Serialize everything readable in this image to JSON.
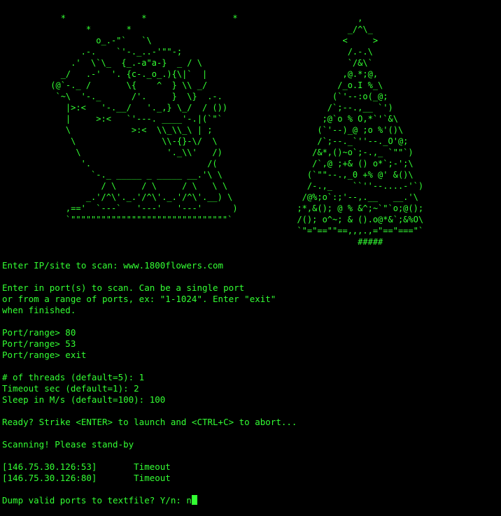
{
  "colors": {
    "background": "#000000",
    "text": "#33ff33"
  },
  "art": {
    "left": "            *               *                 *\n                 *       *\n                   o_.-\"`   `\\\n                .-.    `'-._..-'\"\"-;\n              .'  \\`\\_  {_.-a\"a-}  _ / \\\n            _/   .-'  '. {c-._o_.){\\|`  |\n          (@`-._ /       \\{    ^  } \\\\ _/\n           `~\\  '-._      /'.     }  \\}  .-.\n             |>:<   '-.__/   '._,} \\_/  / ())\n             |     >:<   `'---. ____'-.|(`\"`\n             \\            >:<  \\\\_\\\\_\\ | ;\n              \\                 \\\\-{}-\\/  \\\n               \\                 '._\\\\'   /)\n                '.                       /(\n                  `-._ _____ _ _____ __.'\\ \\\n                    / \\     / \\     / \\   \\ \\\n                 _.'/^\\'._.'/^\\'._.'/^\\'.__) \\\n             ,=='  `---`   '---'   '---'      )\n             `\"\"\"\"\"\"\"\"\"\"\"\"\"\"\"\"\"\"\"\"\"\"\"\"\"\"\"\"\"\"\"`",
    "right": "              ,\n            _/^\\_\n           <     >\n            /.-.\\\n            `/&\\`\n           ,@.*;@,\n          /_o.I %_\\\n         (`'--:o(_@;\n        /`;--.,__ `')\n       ;@`o % O,*`'`&\\\n      (`'--)_@ ;o %'()\\\n      /`;--._`''--._O'@;\n     /&*,()~o`;-.,_ `\"\"`)\n     /`,@ ;+& () o*`;-';\\\n    (`\"\"--.,_0 +% @' &()\\\n    /-.,_    ``''--....-'`)\n   /@%;o`:;'--,.__   __.'\\\n  ;*,&(); @ % &^;~`\"`o;@();\n  /(); o^~; & ().o@*&`;&%O\\\n  `\"=\"==\"\"==,,,.,=\"==\"===\"`\n              #####",
    "stars": "                                                                             *\n                                                         *\n                                                                         *                *         *\n   *                                                       *\n                                                                                             *\n                                                                                                     *\n                                                           *              *\n                                                                   *             *\n                                                                 *\n   *                                                      *\n                                                                                                     *\n                                                         *   *\n                                                                                                     *\n          *                                                                        *\n                                                                *\n                                                                                                     *\n       *                                                                                    *\n                                                               *"
  },
  "output": {
    "prompt_site": "Enter IP/site to scan: www.1800flowers.com",
    "port_help_1": "Enter in port(s) to scan. Can be a single port",
    "port_help_2": "or from a range of ports, ex: \"1-1024\". Enter \"exit\"",
    "port_help_3": "when finished.",
    "port_line_1": "Port/range> 80",
    "port_line_2": "Port/range> 53",
    "port_line_3": "Port/range> exit",
    "threads": "# of threads (default=5): 1",
    "timeout": "Timeout sec (default=1): 2",
    "sleep": "Sleep in M/s (default=100): 100",
    "ready": "Ready? Strike <ENTER> to launch and <CTRL+C> to abort...",
    "scanning": "Scanning! Please stand-by",
    "results": [
      "[146.75.30.126:53]       Timeout",
      "[146.75.30.126:80]       Timeout"
    ],
    "dump_prompt": "Dump valid ports to textfile? Y/n: ",
    "dump_input": "n"
  }
}
